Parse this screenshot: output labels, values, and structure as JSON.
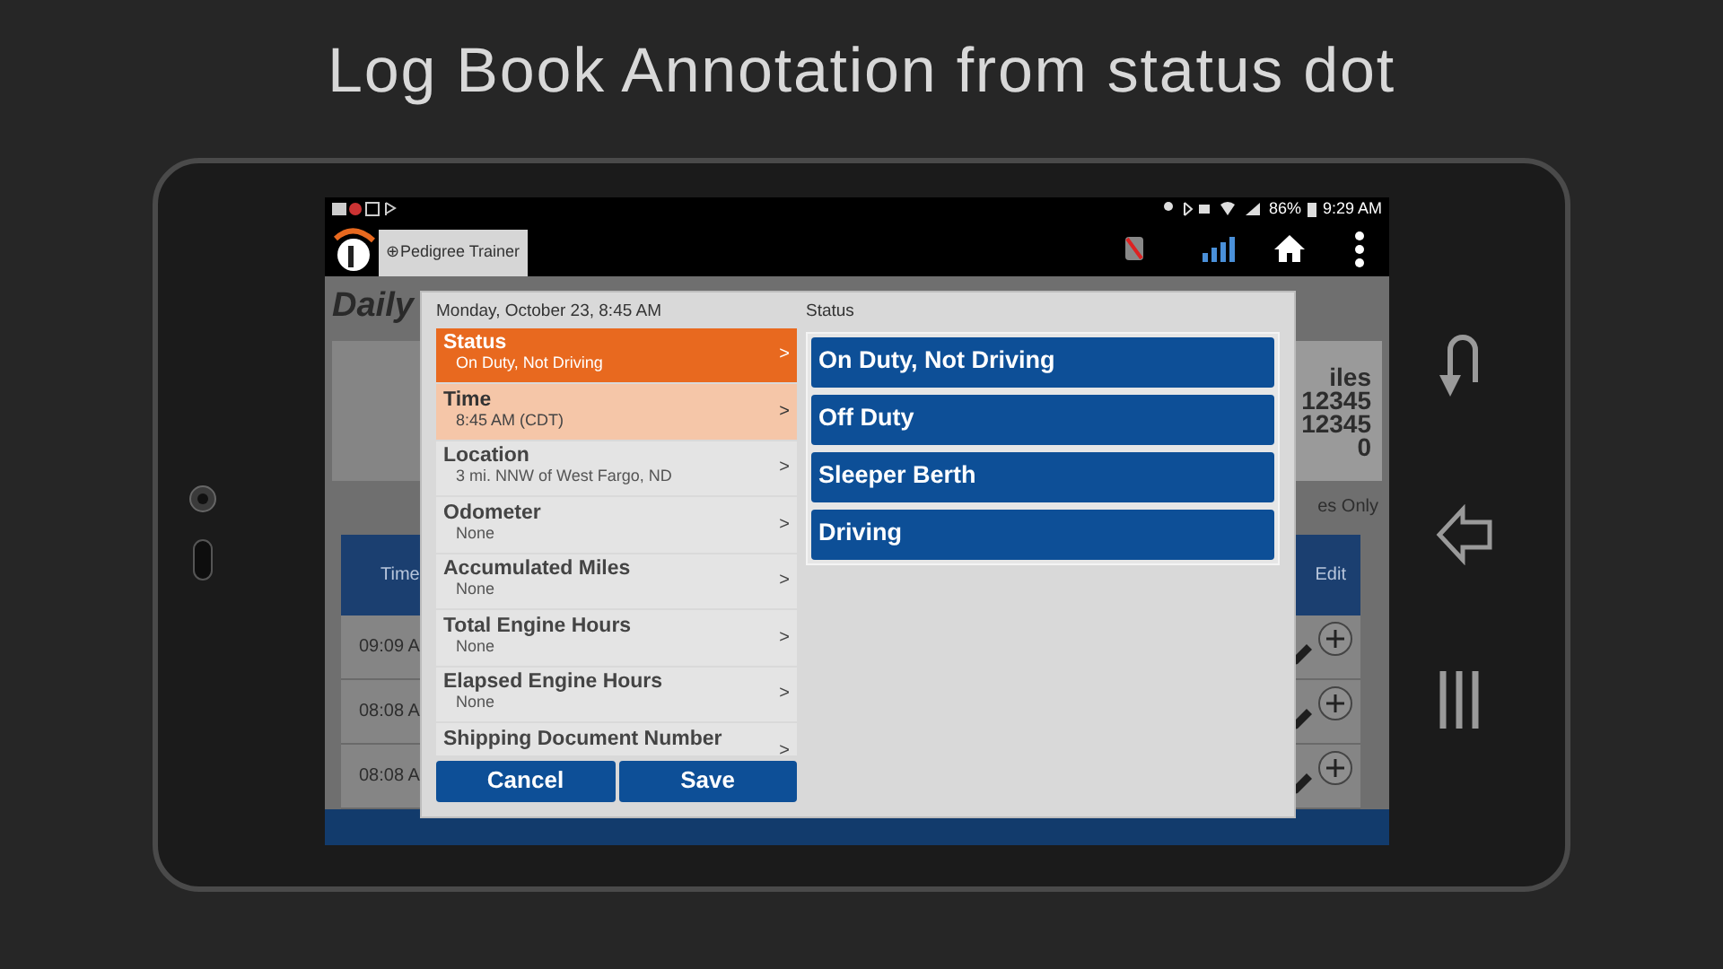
{
  "slide_title": "Log Book Annotation from status dot",
  "status_bar": {
    "battery": "86%",
    "time": "9:29 AM"
  },
  "app_bar": {
    "tab": "⊕Pedigree Trainer"
  },
  "background": {
    "heading": "Daily",
    "summary_label": "iles",
    "summary_values": [
      "12345",
      "12345",
      "0"
    ],
    "filter_label": "es Only",
    "table_columns": [
      "Time",
      "Edit"
    ],
    "table_rows": [
      "09:09 A",
      "08:08 A",
      "08:08 A"
    ]
  },
  "dialog": {
    "date": "Monday, October 23, 8:45 AM",
    "fields": [
      {
        "label": "Status",
        "value": "On Duty, Not Driving",
        "selected": true,
        "edited": false
      },
      {
        "label": "Time",
        "value": "8:45 AM (CDT)",
        "selected": false,
        "edited": true
      },
      {
        "label": "Location",
        "value": "3 mi. NNW of West Fargo, ND",
        "selected": false,
        "edited": false
      },
      {
        "label": "Odometer",
        "value": "None",
        "selected": false,
        "edited": false
      },
      {
        "label": "Accumulated Miles",
        "value": "None",
        "selected": false,
        "edited": false
      },
      {
        "label": "Total Engine Hours",
        "value": "None",
        "selected": false,
        "edited": false
      },
      {
        "label": "Elapsed Engine Hours",
        "value": "None",
        "selected": false,
        "edited": false
      },
      {
        "label": "Shipping Document Number",
        "selected": false,
        "edited": false
      }
    ],
    "chevron": ">",
    "buttons": [
      "Cancel",
      "Save"
    ],
    "options_title": "Status",
    "options": [
      "On Duty, Not Driving",
      "Off Duty",
      "Sleeper Berth",
      "Driving"
    ]
  }
}
